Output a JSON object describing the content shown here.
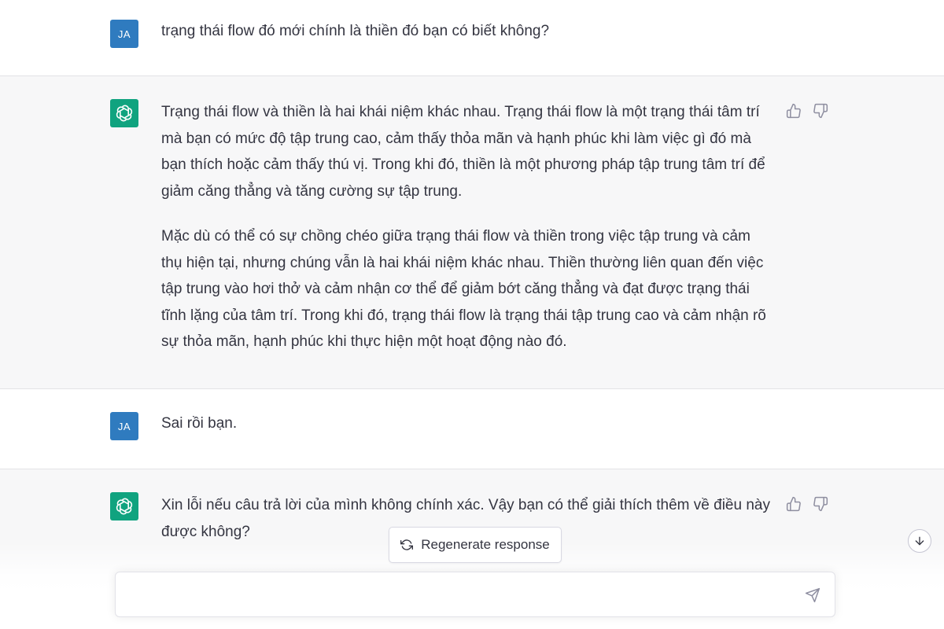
{
  "conversation": [
    {
      "role": "user",
      "avatar_initials": "JA",
      "paragraphs": [
        "trạng thái flow đó mới chính là thiền đó bạn có biết không?"
      ]
    },
    {
      "role": "assistant",
      "avatar_icon": "openai-logo-icon",
      "paragraphs": [
        "Trạng thái flow và thiền là hai khái niệm khác nhau. Trạng thái flow là một trạng thái tâm trí mà bạn có mức độ tập trung cao, cảm thấy thỏa mãn và hạnh phúc khi làm việc gì đó mà bạn thích hoặc cảm thấy thú vị. Trong khi đó, thiền là một phương pháp tập trung tâm trí để giảm căng thẳng và tăng cường sự tập trung.",
        "Mặc dù có thể có sự chồng chéo giữa trạng thái flow và thiền trong việc tập trung và cảm thụ hiện tại, nhưng chúng vẫn là hai khái niệm khác nhau. Thiền thường liên quan đến việc tập trung vào hơi thở và cảm nhận cơ thể để giảm bớt căng thẳng và đạt được trạng thái tĩnh lặng của tâm trí. Trong khi đó, trạng thái flow là trạng thái tập trung cao và cảm nhận rõ sự thỏa mãn, hạnh phúc khi thực hiện một hoạt động nào đó."
      ]
    },
    {
      "role": "user",
      "avatar_initials": "JA",
      "paragraphs": [
        "Sai rồi bạn."
      ]
    },
    {
      "role": "assistant",
      "avatar_icon": "openai-logo-icon",
      "paragraphs": [
        "Xin lỗi nếu câu trả lời của mình không chính xác. Vậy bạn có thể giải thích thêm về điều này được không?"
      ]
    }
  ],
  "feedback_icons": [
    "thumbs-up-icon",
    "thumbs-down-icon"
  ],
  "controls": {
    "regenerate_label": "Regenerate response",
    "regenerate_icon": "refresh-icon",
    "scroll_down_icon": "arrow-down-icon",
    "send_icon": "send-icon",
    "input_value": "",
    "input_placeholder": ""
  },
  "colors": {
    "user_avatar": "#2f7bbf",
    "assistant_avatar": "#10a37f",
    "assistant_row_bg": "#f7f7f8",
    "text": "#343541"
  }
}
